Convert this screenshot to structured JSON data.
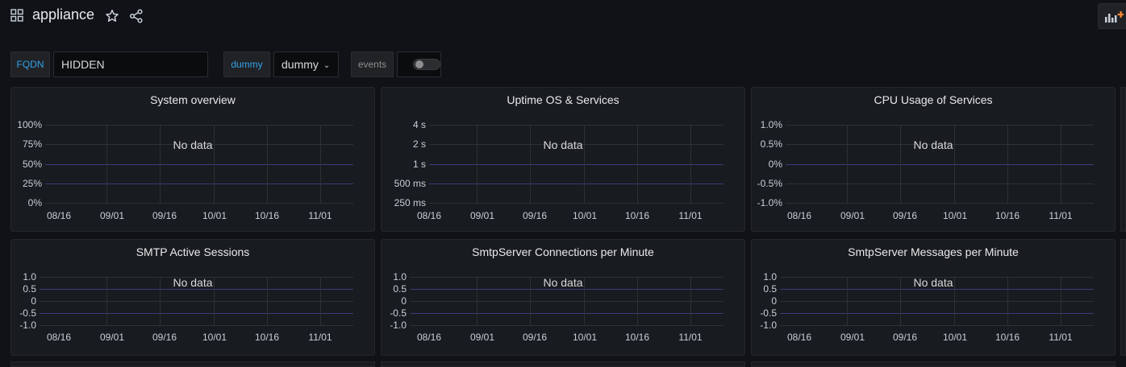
{
  "header": {
    "title": "appliance",
    "icons": [
      "grid-icon",
      "star-icon",
      "share-icon",
      "add-panel-icon"
    ]
  },
  "variables": {
    "fqdn_label": "FQDN",
    "fqdn_value": "HIDDEN",
    "dummy_label": "dummy",
    "dummy_value": "dummy",
    "events_label": "events",
    "events_enabled": false
  },
  "colors": {
    "background": "#111217",
    "panel": "#181b1f",
    "variable_label": "#33a2e5",
    "grid": "#2c3235",
    "zero_line": "#3b3c7a"
  },
  "panels": [
    {
      "title": "System overview",
      "no_data": "No data",
      "y_ticks": [
        "100%",
        "75%",
        "50%",
        "25%",
        "0%"
      ]
    },
    {
      "title": "Uptime OS & Services",
      "no_data": "No data",
      "y_ticks": [
        "4 s",
        "2 s",
        "1 s",
        "500 ms",
        "250 ms"
      ]
    },
    {
      "title": "CPU Usage of Services",
      "no_data": "No data",
      "y_ticks": [
        "1.0%",
        "0.5%",
        "0%",
        "-0.5%",
        "-1.0%"
      ]
    },
    {
      "title": "SMTP Active Sessions",
      "no_data": "No data",
      "y_ticks": [
        "1.0",
        "0.5",
        "0",
        "-0.5",
        "-1.0"
      ]
    },
    {
      "title": "SmtpServer Connections per Minute",
      "no_data": "No data",
      "y_ticks": [
        "1.0",
        "0.5",
        "0",
        "-0.5",
        "-1.0"
      ]
    },
    {
      "title": "SmtpServer Messages per Minute",
      "no_data": "No data",
      "y_ticks": [
        "1.0",
        "0.5",
        "0",
        "-0.5",
        "-1.0"
      ]
    }
  ],
  "x_ticks": [
    "08/16",
    "09/01",
    "09/16",
    "10/01",
    "10/16",
    "11/01"
  ]
}
